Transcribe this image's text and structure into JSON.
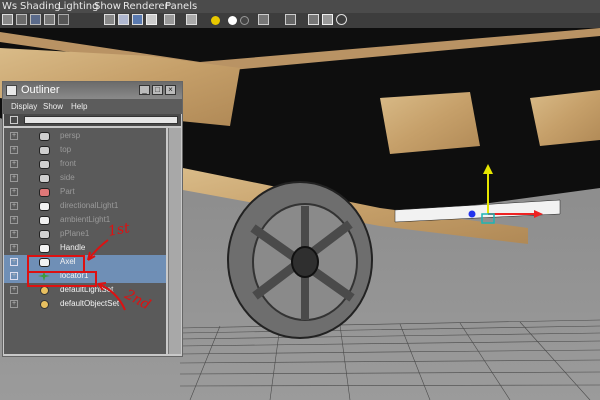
{
  "menubar": {
    "items": [
      "Ws",
      "Shading",
      "Lighting",
      "Show",
      "Renderer",
      "Panels"
    ]
  },
  "toolbar": {
    "icons": [
      "camera-icon",
      "lock-icon",
      "grid-icon",
      "resolution-gate-icon",
      "film-gate-icon",
      "wireframe-icon",
      "smooth-shade-icon",
      "textured-icon",
      "default-light-icon",
      "all-lights-icon",
      "shadows-icon",
      "cube-icon",
      "isolate-icon",
      "xray-icon",
      "share-icon"
    ]
  },
  "outliner": {
    "title": "Outliner",
    "menu": [
      "Display",
      "Show",
      "Help"
    ],
    "rows": [
      {
        "label": "persp",
        "icon": "camera-icon",
        "state": "dim"
      },
      {
        "label": "top",
        "icon": "camera-icon",
        "state": "dim"
      },
      {
        "label": "front",
        "icon": "camera-icon",
        "state": "dim"
      },
      {
        "label": "side",
        "icon": "camera-icon",
        "state": "dim"
      },
      {
        "label": "Part",
        "icon": "mesh-icon",
        "state": "dim"
      },
      {
        "label": "directionalLight1",
        "icon": "directional-light-icon",
        "state": "dim"
      },
      {
        "label": "ambientLight1",
        "icon": "ambient-light-icon",
        "state": "dim"
      },
      {
        "label": "pPlane1",
        "icon": "plane-icon",
        "state": "dim"
      },
      {
        "label": "Handle",
        "icon": "group-icon",
        "state": "bright"
      },
      {
        "label": "Axel",
        "icon": "group-icon",
        "state": "selected"
      },
      {
        "label": "locator1",
        "icon": "locator-icon",
        "state": "selected"
      },
      {
        "label": "defaultLightSet",
        "icon": "set-icon",
        "state": "bright"
      },
      {
        "label": "defaultObjectSet",
        "icon": "set-icon",
        "state": "bright"
      }
    ]
  },
  "annotations": {
    "first": "1st",
    "second": "2nd"
  },
  "colors": {
    "selection": "#6f8fb6",
    "annotation": "#dd1111",
    "wood": "#c9a46e"
  }
}
